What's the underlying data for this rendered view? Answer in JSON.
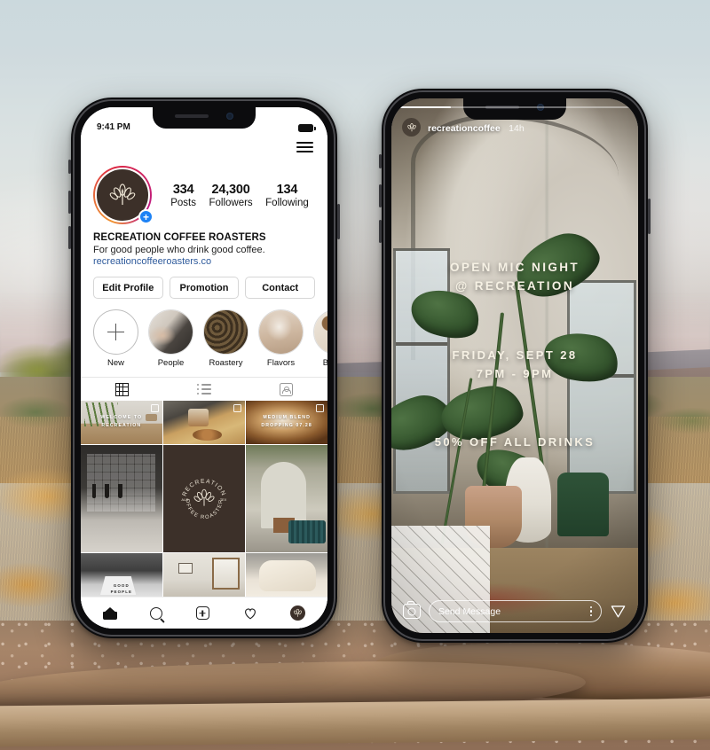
{
  "scene": {
    "description": "Instagram profile and story mockup on two phones over a desert landscape background"
  },
  "phone_left": {
    "status_bar": {
      "time": "9:41 PM",
      "battery_icon": "battery-icon"
    },
    "top_bar": {
      "menu_icon": "hamburger-menu-icon"
    },
    "profile": {
      "avatar_icon": "coffee-plant-logo",
      "add_story_badge": "+",
      "stats": [
        {
          "number": "334",
          "label": "Posts"
        },
        {
          "number": "24,300",
          "label": "Followers"
        },
        {
          "number": "134",
          "label": "Following"
        }
      ],
      "name": "RECREATION COFFEE ROASTERS",
      "description": "For good people who drink good coffee.",
      "link": "recreationcoffeeroasters.co",
      "link_color": "#2f5b9c"
    },
    "actions": [
      {
        "label": "Edit Profile"
      },
      {
        "label": "Promotion"
      },
      {
        "label": "Contact"
      }
    ],
    "highlights": [
      {
        "label": "New",
        "type": "add"
      },
      {
        "label": "People",
        "type": "photo"
      },
      {
        "label": "Roastery",
        "type": "photo"
      },
      {
        "label": "Flavors",
        "type": "photo"
      },
      {
        "label": "Behind",
        "type": "photo"
      }
    ],
    "tabs": [
      {
        "name": "grid-tab",
        "icon": "grid-icon",
        "active": true
      },
      {
        "name": "list-tab",
        "icon": "list-icon",
        "active": false
      },
      {
        "name": "tagged-tab",
        "icon": "tagged-person-icon",
        "active": false
      }
    ],
    "grid": [
      {
        "caption": "WELCOME TO RECREATION",
        "tagged": true
      },
      {
        "caption": "",
        "tagged": true
      },
      {
        "caption": "MEDIUM BLEND\nDROPPING 07.28",
        "tagged": true
      },
      {
        "caption": "",
        "tagged": false
      },
      {
        "caption": "",
        "tagged": false,
        "logo": true
      },
      {
        "caption": "",
        "tagged": false
      },
      {
        "caption": "GOOD\nPEOPLE",
        "tagged": false
      },
      {
        "caption": "",
        "tagged": false
      },
      {
        "caption": "",
        "tagged": false
      }
    ],
    "logo_badge": {
      "top_text": "RECREATION",
      "bottom_text": "COFFEE ROASTERS",
      "left_text": "AUS",
      "right_text": "TEX"
    },
    "bottom_nav": [
      {
        "name": "nav-home",
        "icon": "home-icon"
      },
      {
        "name": "nav-search",
        "icon": "search-icon"
      },
      {
        "name": "nav-add",
        "icon": "plus-square-icon"
      },
      {
        "name": "nav-activity",
        "icon": "heart-icon"
      },
      {
        "name": "nav-profile",
        "icon": "profile-avatar-icon"
      }
    ]
  },
  "phone_right": {
    "story": {
      "username": "recreationcoffee",
      "time_ago": "14h",
      "avatar_icon": "coffee-plant-logo",
      "line1": "OPEN MIC NIGHT",
      "line2": "@ RECREATION",
      "line3": "FRIDAY, SEPT 28",
      "line4": "7PM - 9PM",
      "line5": "50% OFF ALL DRINKS",
      "text_color": "#f6f1e4"
    },
    "footer": {
      "camera_icon": "camera-icon",
      "message_placeholder": "Send Message",
      "more_icon": "more-vertical-icon",
      "send_icon": "send-paper-plane-icon"
    }
  }
}
